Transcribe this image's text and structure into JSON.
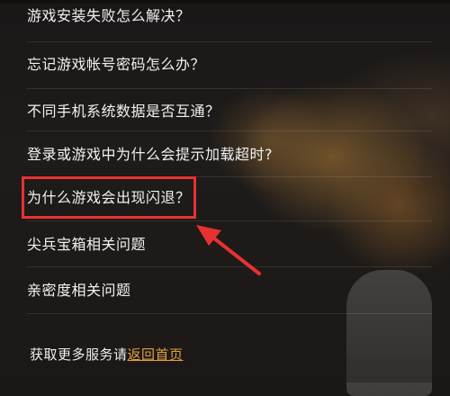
{
  "faq": {
    "items": [
      "游戏安装失败怎么解决？",
      "忘记游戏帐号密码怎么办？",
      "不同手机系统数据是否互通？",
      "登录或游戏中为什么会提示加载超时?",
      "为什么游戏会出现闪退？",
      "尖兵宝箱相关问题",
      "亲密度相关问题"
    ]
  },
  "footer": {
    "text": "获取更多服务请",
    "link": "返回首页"
  },
  "colors": {
    "highlight": "#e63232",
    "link": "#e3a13d"
  }
}
